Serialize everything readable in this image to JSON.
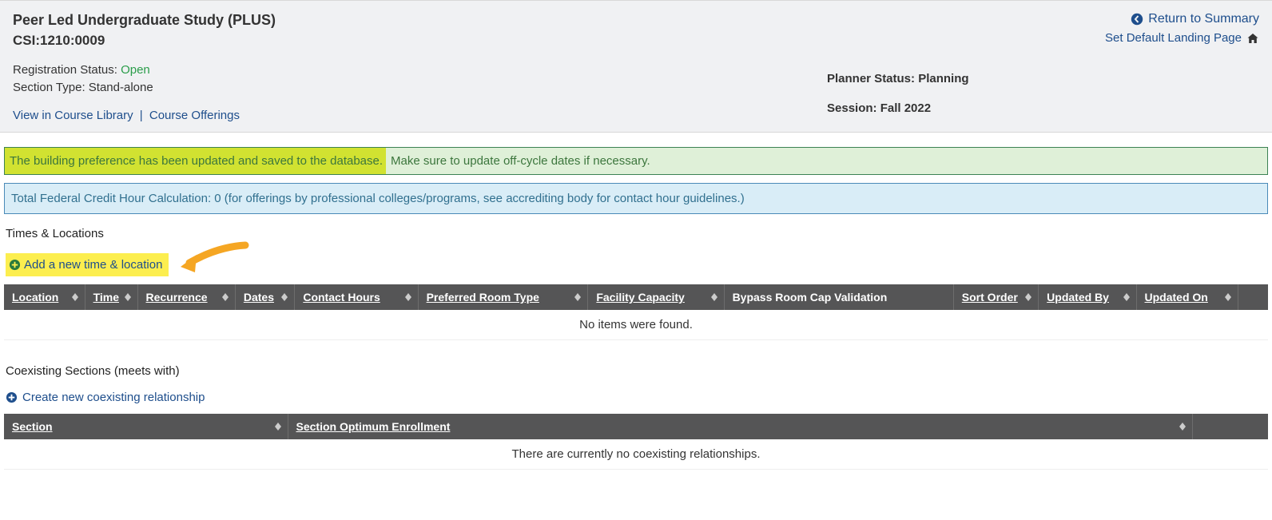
{
  "header": {
    "course_title": "Peer Led Undergraduate Study (PLUS)",
    "course_code": "CSI:1210:0009",
    "reg_status_label": "Registration Status: ",
    "reg_status_value": "Open",
    "section_type_label": "Section Type: ",
    "section_type_value": "Stand-alone",
    "view_course_library": "View in Course Library",
    "course_offerings": "Course Offerings",
    "return_summary": "Return to Summary",
    "default_landing": "Set Default Landing Page",
    "planner_status_label": "Planner Status: ",
    "planner_status_value": "Planning",
    "session_label": "Session: ",
    "session_value": "Fall 2022"
  },
  "alerts": {
    "success_hl": "The building preference has been updated and saved to the database.",
    "success_rest": " Make sure to update off-cycle dates if necessary.",
    "info": "Total Federal Credit Hour Calculation: 0 (for offerings by professional colleges/programs, see accrediting body for contact hour guidelines.)"
  },
  "times_locations": {
    "heading": "Times & Locations",
    "add_link": "Add a new time & location",
    "columns": {
      "location": "Location",
      "time": "Time",
      "recurrence": "Recurrence",
      "dates": "Dates",
      "contact_hours": "Contact Hours",
      "preferred_room": "Preferred Room Type",
      "facility_capacity": "Facility Capacity",
      "bypass": "Bypass Room Cap Validation",
      "sort_order": "Sort Order",
      "updated_by": "Updated By",
      "updated_on": "Updated On"
    },
    "empty": "No items were found."
  },
  "coexisting": {
    "heading": "Coexisting Sections (meets with)",
    "create_link": "Create new coexisting relationship",
    "columns": {
      "section": "Section",
      "optimum": "Section Optimum Enrollment"
    },
    "empty": "There are currently no coexisting relationships."
  }
}
